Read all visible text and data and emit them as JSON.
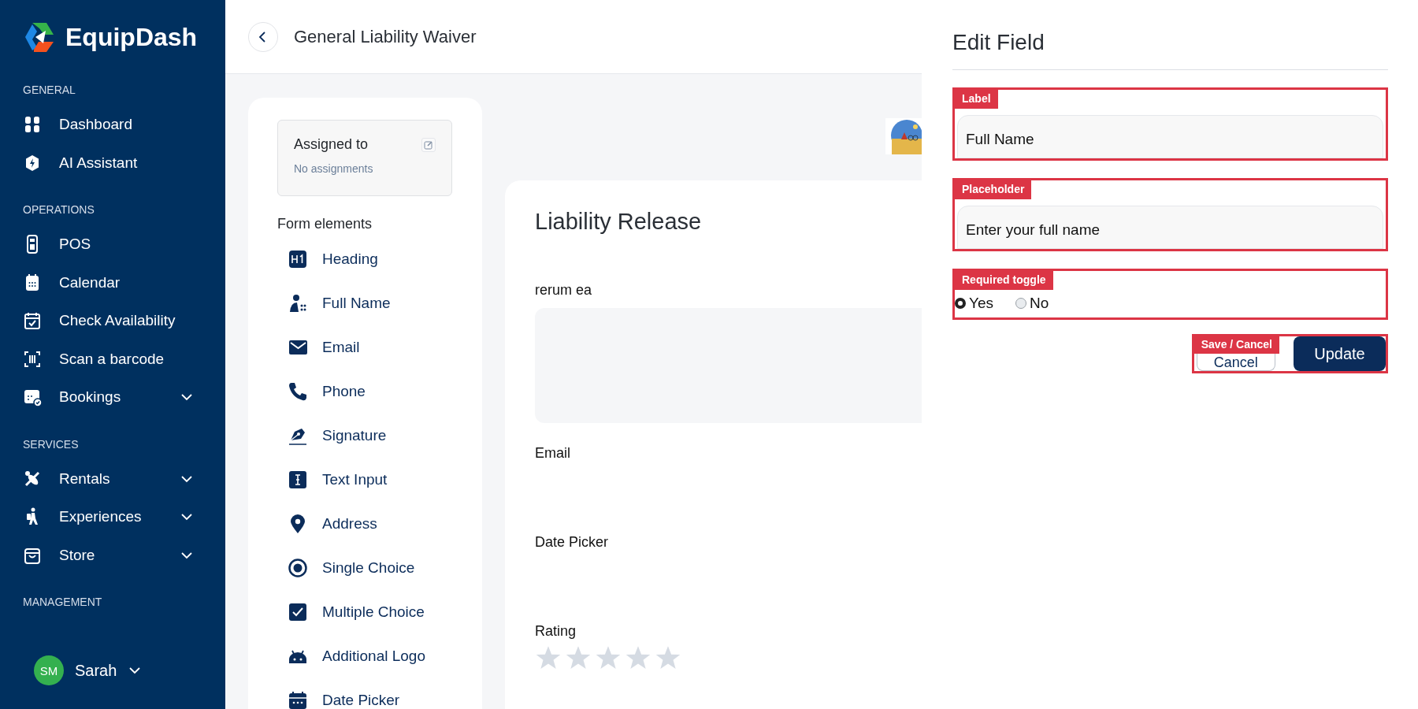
{
  "brand": {
    "name": "EquipDash"
  },
  "sidebar": {
    "sections": [
      {
        "title": "GENERAL",
        "items": [
          {
            "label": "Dashboard",
            "kind": "grid",
            "submenu": false
          },
          {
            "label": "AI Assistant",
            "kind": "bolt",
            "submenu": false
          }
        ]
      },
      {
        "title": "OPERATIONS",
        "items": [
          {
            "label": "POS",
            "kind": "terminal",
            "submenu": false
          },
          {
            "label": "Calendar",
            "kind": "calendar",
            "submenu": false
          },
          {
            "label": "Check Availability",
            "kind": "check",
            "submenu": false
          },
          {
            "label": "Scan a barcode",
            "kind": "barcode",
            "submenu": false
          },
          {
            "label": "Bookings",
            "kind": "bookings",
            "submenu": true
          }
        ]
      },
      {
        "title": "SERVICES",
        "items": [
          {
            "label": "Rentals",
            "kind": "paddle",
            "submenu": true
          },
          {
            "label": "Experiences",
            "kind": "hiker",
            "submenu": true
          },
          {
            "label": "Store",
            "kind": "bag",
            "submenu": true
          }
        ]
      },
      {
        "title": "MANAGEMENT"
      }
    ],
    "user": {
      "initials": "SM",
      "name": "Sarah"
    }
  },
  "header": {
    "title": "General Liability Waiver"
  },
  "assigned": {
    "title": "Assigned to",
    "value": "No assignments"
  },
  "form_elements": {
    "title": "Form elements",
    "items": [
      {
        "label": "Heading",
        "kind": "heading"
      },
      {
        "label": "Full Name",
        "kind": "person"
      },
      {
        "label": "Email",
        "kind": "mail"
      },
      {
        "label": "Phone",
        "kind": "phone"
      },
      {
        "label": "Signature",
        "kind": "pen"
      },
      {
        "label": "Text Input",
        "kind": "textinput"
      },
      {
        "label": "Address",
        "kind": "pin"
      },
      {
        "label": "Single Choice",
        "kind": "radio"
      },
      {
        "label": "Multiple Choice",
        "kind": "checkbox"
      },
      {
        "label": "Additional Logo",
        "kind": "android"
      },
      {
        "label": "Date Picker",
        "kind": "date"
      }
    ]
  },
  "preview": {
    "title": "Liability Release",
    "fields": [
      {
        "label": "rerum ea",
        "kind": "textarea"
      },
      {
        "label": "Email",
        "kind": "blank"
      },
      {
        "label": "Date Picker",
        "kind": "blank"
      },
      {
        "label": "Rating",
        "kind": "rating",
        "stars": 0
      }
    ]
  },
  "edit_panel": {
    "title": "Edit Field",
    "fields": [
      {
        "kind": "text",
        "annotation": "Label",
        "value": "Full Name"
      },
      {
        "kind": "text",
        "annotation": "Placeholder",
        "value": "Enter your full name"
      },
      {
        "kind": "radio",
        "annotation": "Required toggle",
        "options": [
          {
            "label": "Yes",
            "selected": true
          },
          {
            "label": "No",
            "selected": false
          }
        ]
      }
    ],
    "actions": {
      "annotation": "Save / Cancel",
      "buttons": [
        {
          "label": "Cancel",
          "kind": "secondary"
        },
        {
          "label": "Update",
          "kind": "primary"
        }
      ]
    }
  }
}
